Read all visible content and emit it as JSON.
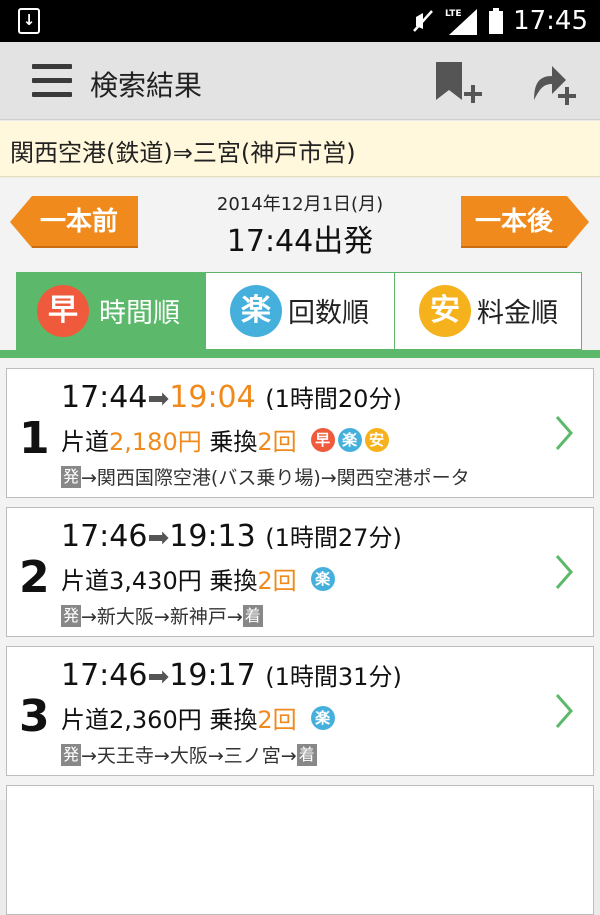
{
  "status_bar": {
    "time": "17:45",
    "network": "LTE"
  },
  "header": {
    "title": "検索結果"
  },
  "route": {
    "text": "関西空港(鉄道)⇒三宮(神戸市営)"
  },
  "nav": {
    "prev_label": "一本前",
    "next_label": "一本後",
    "date": "2014年12月1日(月)",
    "departure": "17:44出発"
  },
  "tabs": [
    {
      "icon_char": "早",
      "label": "時間順",
      "color": "#f05a3c"
    },
    {
      "icon_char": "楽",
      "label": "回数順",
      "color": "#46b0dd"
    },
    {
      "icon_char": "安",
      "label": "料金順",
      "color": "#f5b21c"
    }
  ],
  "results": [
    {
      "num": "1",
      "depart": "17:44",
      "arrive": "19:04",
      "duration": "(1時間20分)",
      "fare_prefix": "片道",
      "fare": "2,180円",
      "transfer_prefix": "乗換",
      "transfers": "2回",
      "badges": [
        "早",
        "楽",
        "安"
      ],
      "route_start": "発",
      "route_text": "→関西国際空港(バス乗り場)→関西空港ポータ",
      "route_end": ""
    },
    {
      "num": "2",
      "depart": "17:46",
      "arrive": "19:13",
      "duration": "(1時間27分)",
      "fare_prefix": "片道",
      "fare": "3,430円",
      "transfer_prefix": "乗換",
      "transfers": "2回",
      "badges": [
        "楽"
      ],
      "route_start": "発",
      "route_text": "→新大阪→新神戸→",
      "route_end": "着"
    },
    {
      "num": "3",
      "depart": "17:46",
      "arrive": "19:17",
      "duration": "(1時間31分)",
      "fare_prefix": "片道",
      "fare": "2,360円",
      "transfer_prefix": "乗換",
      "transfers": "2回",
      "badges": [
        "楽"
      ],
      "route_start": "発",
      "route_text": "→天王寺→大阪→三ノ宮→",
      "route_end": "着"
    }
  ],
  "colors": {
    "accent_green": "#5cb96b",
    "button_orange": "#f08a1c",
    "arrival_orange": "#f08a1c"
  }
}
